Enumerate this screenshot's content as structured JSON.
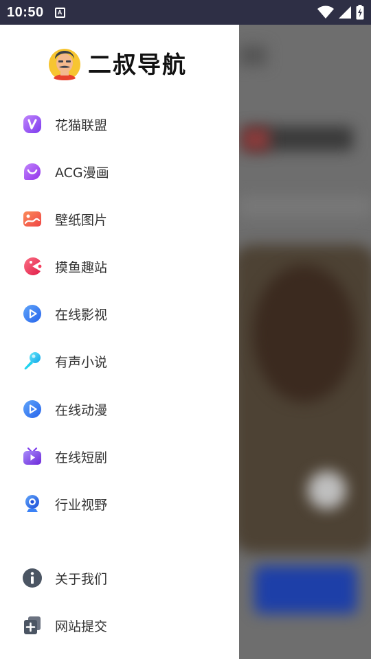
{
  "status_bar": {
    "time": "10:50",
    "notification_icon": "a-icon",
    "icons": [
      "wifi-icon",
      "signal-icon",
      "battery-charging-icon"
    ]
  },
  "drawer": {
    "brand": {
      "title": "二叔导航",
      "logo_icon": "mascot-avatar-icon"
    },
    "menu_items": [
      {
        "label": "花猫联盟",
        "icon": "v-badge-icon",
        "color": "#9b5de5"
      },
      {
        "label": "ACG漫画",
        "icon": "smile-bubble-icon",
        "color": "#a855f7"
      },
      {
        "label": "壁纸图片",
        "icon": "image-icon",
        "color": "#f0714a"
      },
      {
        "label": "摸鱼趣站",
        "icon": "pacman-icon",
        "color": "#f43f5e"
      },
      {
        "label": "在线影视",
        "icon": "play-circle-icon",
        "color": "#3b82f6"
      },
      {
        "label": "有声小说",
        "icon": "microphone-icon",
        "color": "#38bdf8"
      },
      {
        "label": "在线动漫",
        "icon": "play-circle-icon",
        "color": "#3b82f6"
      },
      {
        "label": "在线短剧",
        "icon": "tv-icon",
        "color": "#8b5cf6"
      },
      {
        "label": "行业视野",
        "icon": "webcam-icon",
        "color": "#3b82f6"
      },
      {
        "label": "关于我们",
        "icon": "info-icon",
        "color": "#4b5563"
      },
      {
        "label": "网站提交",
        "icon": "add-copy-icon",
        "color": "#4b5563"
      }
    ]
  },
  "colors": {
    "status_bar_bg": "#2e2f45",
    "drawer_bg": "#ffffff",
    "scrim": "#6e6e6e",
    "text": "#333333"
  }
}
